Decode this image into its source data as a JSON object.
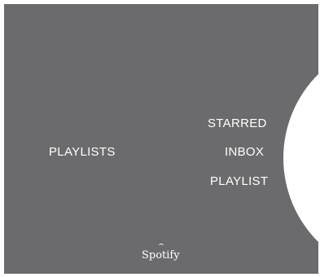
{
  "menu": {
    "left_label": "PLAYLISTS",
    "items": [
      {
        "label": "STARRED"
      },
      {
        "label": "INBOX"
      },
      {
        "label": "PLAYLIST"
      }
    ]
  },
  "brand": {
    "name": "Spotify"
  },
  "colors": {
    "panel": "#6b6b6d",
    "text": "#ffffff",
    "disc": "#ffffff"
  },
  "icons": {
    "disc": "round-disc-icon",
    "brand": "spotify-logo"
  }
}
